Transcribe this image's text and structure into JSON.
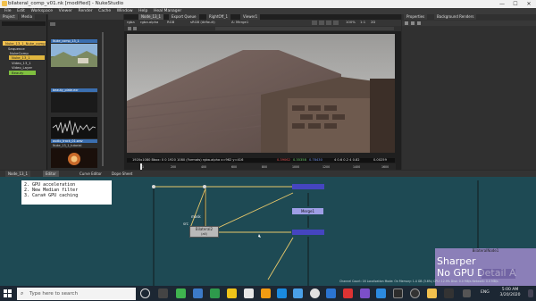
{
  "window": {
    "title": "bilateral_comp_v01.nk [modified] - NukeStudio",
    "minimize": "—",
    "maximize": "☐",
    "close": "✕"
  },
  "menu": [
    "File",
    "Edit",
    "Workspace",
    "Viewer",
    "Render",
    "Cache",
    "Window",
    "Help",
    "Heal Manager"
  ],
  "project_panel": {
    "tabs": [
      "Project",
      "Media"
    ],
    "tree": [
      {
        "label": "Nuke_13_1_Nuke_comp",
        "style": "sel"
      },
      {
        "label": "Sequence",
        "style": ""
      },
      {
        "label": "NukeComp",
        "style": ""
      },
      {
        "label": "Nuke_13_1",
        "style": "yel"
      },
      {
        "label": "Video_13_1",
        "style": ""
      },
      {
        "label": "Video_Layer",
        "style": ""
      },
      {
        "label": "Beauty",
        "style": "grn"
      }
    ]
  },
  "bin": {
    "clips": [
      {
        "label": "Nuke_comp_13_1"
      },
      {
        "label": "beauty_plate.exr"
      },
      {
        "label": "audio_track_01.wav"
      },
      {
        "label": "Nuke_13_1_tutorial"
      }
    ]
  },
  "viewer": {
    "tabs": [
      "Node_13_1",
      "Export Queue",
      "RightOff_1",
      "Viewer1"
    ],
    "channel": "rgba",
    "channel_alpha": "rgba.alpha",
    "colorspace": "RGB",
    "display": "sRGB (default)",
    "merge": "A: Merge1",
    "zoom": "100%",
    "proxy": "1:1",
    "mode": "2D",
    "info_text": "1920x1080  Bbox: 0 0 1920 1080 (Formats)  rgba.alpha  x=962 y=416",
    "info_values": [
      "0.39062",
      "0.35358",
      "0.78430",
      "4 0.6 0.2 4 0.82",
      "0.00259"
    ],
    "frame_start": "1",
    "frame_end": "100",
    "fps": "24*",
    "playback": "Global",
    "current_frame": "1",
    "ticks": [
      "1",
      "200",
      "400",
      "600",
      "800",
      "1000",
      "1200",
      "1400",
      "1600"
    ],
    "frame_range": "1600"
  },
  "right_panel": {
    "tabs": [
      "Properties",
      "Background Renders"
    ]
  },
  "nodegraph": {
    "tabs": [
      "Node_13_1",
      "Editor",
      "Curve Editor",
      "Dope Sheet"
    ],
    "note_lines": [
      "2. GPU acceleration",
      "2. New Median filter",
      "3. Cara® GPU caching"
    ],
    "bilateral_node": "Bilateral2",
    "bilateral_sub": "(all)",
    "merge_label": "Merge1",
    "input_a": "mask",
    "input_b": "src",
    "status_title": "BilateralNode1",
    "status_line1": "Sharper",
    "status_line2": "No GPU Detail A",
    "status_bar": "Channel Count: 16  Localization Mode: On  Memory: 1.4 GB (3.6%)  CPU: 12.9%  Disk: 0.0 MB/s  Network: 0.0 MB/s"
  },
  "taskbar": {
    "search_placeholder": "Type here to search",
    "lang": "ENG",
    "time": "5:00 AM",
    "date": "3/20/2020"
  },
  "colors": {
    "accent": "#f2c14e",
    "nodegraph_bg": "#1e4a54",
    "node_purple": "#6b6bd6",
    "node_grey": "#b9b9b9"
  }
}
